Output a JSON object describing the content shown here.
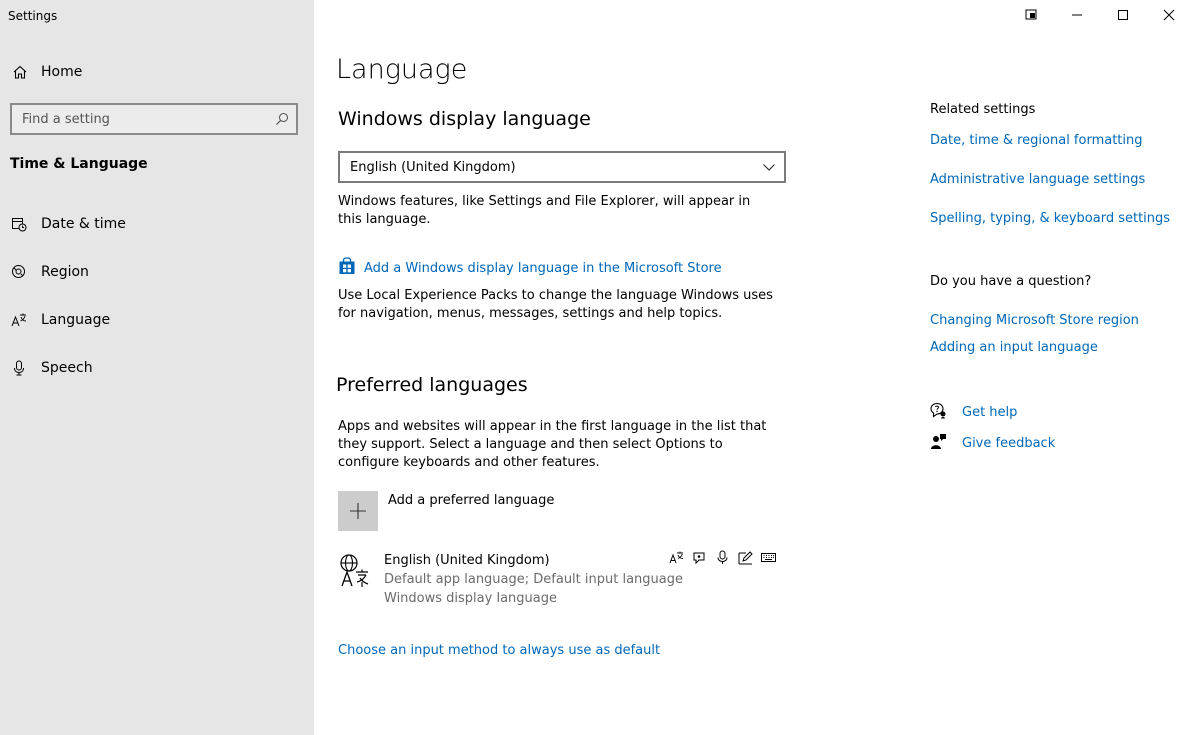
{
  "window": {
    "title": "Settings"
  },
  "sidebar": {
    "home_label": "Home",
    "search_placeholder": "Find a setting",
    "section_title": "Time & Language",
    "items": [
      {
        "label": "Date & time",
        "icon": "calendar-clock-icon"
      },
      {
        "label": "Region",
        "icon": "globe-region-icon"
      },
      {
        "label": "Language",
        "icon": "language-icon"
      },
      {
        "label": "Speech",
        "icon": "microphone-icon"
      }
    ]
  },
  "main": {
    "page_title": "Language",
    "display_language": {
      "heading": "Windows display language",
      "selected": "English (United Kingdom)",
      "description": "Windows features, like Settings and File Explorer, will appear in this language.",
      "store_link": "Add a Windows display language in the Microsoft Store",
      "store_description": "Use Local Experience Packs to change the language Windows uses for navigation, menus, messages, settings and help topics."
    },
    "preferred": {
      "heading": "Preferred languages",
      "description": "Apps and websites will appear in the first language in the list that they support. Select a language and then select Options to configure keyboards and other features.",
      "add_label": "Add a preferred language",
      "languages": [
        {
          "name": "English (United Kingdom)",
          "line1": "Default app language; Default input language",
          "line2": "Windows display language"
        }
      ]
    },
    "choose_input_link": "Choose an input method to always use as default"
  },
  "related": {
    "heading": "Related settings",
    "links": [
      "Date, time & regional formatting",
      "Administrative language settings",
      "Spelling, typing, & keyboard settings"
    ],
    "question_heading": "Do you have a question?",
    "question_links": [
      "Changing Microsoft Store region",
      "Adding an input language"
    ],
    "get_help": "Get help",
    "give_feedback": "Give feedback"
  },
  "colors": {
    "accent": "#0067b8",
    "sidebar_bg": "#e6e6e6"
  }
}
